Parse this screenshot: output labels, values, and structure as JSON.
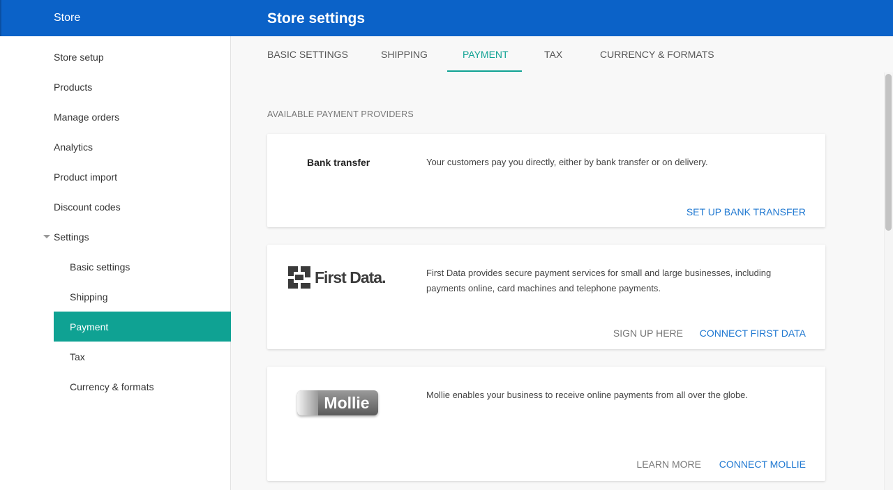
{
  "header": {
    "brand": "Store",
    "title": "Store settings"
  },
  "sidebar": {
    "items": [
      {
        "label": "Store setup"
      },
      {
        "label": "Products"
      },
      {
        "label": "Manage orders"
      },
      {
        "label": "Analytics"
      },
      {
        "label": "Product import"
      },
      {
        "label": "Discount codes"
      },
      {
        "label": "Settings"
      }
    ],
    "sub_items": [
      {
        "label": "Basic settings"
      },
      {
        "label": "Shipping"
      },
      {
        "label": "Payment"
      },
      {
        "label": "Tax"
      },
      {
        "label": "Currency & formats"
      }
    ]
  },
  "tabs": [
    {
      "label": "BASIC SETTINGS"
    },
    {
      "label": "SHIPPING"
    },
    {
      "label": "PAYMENT"
    },
    {
      "label": "TAX"
    },
    {
      "label": "CURRENCY & FORMATS"
    }
  ],
  "main": {
    "section_label": "AVAILABLE PAYMENT PROVIDERS",
    "providers": [
      {
        "name": "Bank transfer",
        "description": "Your customers pay you directly, either by bank transfer or on delivery.",
        "primary_action": "SET UP BANK TRANSFER"
      },
      {
        "logo_text": "First Data.",
        "description": "First Data provides secure payment services for small and large businesses, including payments online, card machines and telephone payments.",
        "secondary_action": "SIGN UP HERE",
        "primary_action": "CONNECT FIRST DATA"
      },
      {
        "logo_text": "Mollie",
        "description": "Mollie enables your business to receive online payments from all over the globe.",
        "secondary_action": "LEARN MORE",
        "primary_action": "CONNECT MOLLIE"
      }
    ]
  },
  "colors": {
    "header_blue": "#0b62c8",
    "accent_teal": "#0fa293",
    "link_blue": "#1f78d1"
  }
}
